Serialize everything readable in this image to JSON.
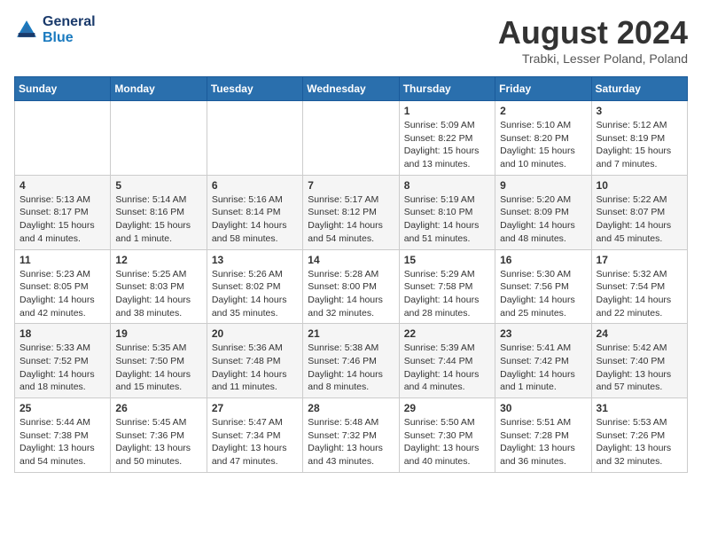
{
  "header": {
    "logo_line1": "General",
    "logo_line2": "Blue",
    "month": "August 2024",
    "location": "Trabki, Lesser Poland, Poland"
  },
  "days_of_week": [
    "Sunday",
    "Monday",
    "Tuesday",
    "Wednesday",
    "Thursday",
    "Friday",
    "Saturday"
  ],
  "weeks": [
    [
      {
        "day": "",
        "info": ""
      },
      {
        "day": "",
        "info": ""
      },
      {
        "day": "",
        "info": ""
      },
      {
        "day": "",
        "info": ""
      },
      {
        "day": "1",
        "info": "Sunrise: 5:09 AM\nSunset: 8:22 PM\nDaylight: 15 hours\nand 13 minutes."
      },
      {
        "day": "2",
        "info": "Sunrise: 5:10 AM\nSunset: 8:20 PM\nDaylight: 15 hours\nand 10 minutes."
      },
      {
        "day": "3",
        "info": "Sunrise: 5:12 AM\nSunset: 8:19 PM\nDaylight: 15 hours\nand 7 minutes."
      }
    ],
    [
      {
        "day": "4",
        "info": "Sunrise: 5:13 AM\nSunset: 8:17 PM\nDaylight: 15 hours\nand 4 minutes."
      },
      {
        "day": "5",
        "info": "Sunrise: 5:14 AM\nSunset: 8:16 PM\nDaylight: 15 hours\nand 1 minute."
      },
      {
        "day": "6",
        "info": "Sunrise: 5:16 AM\nSunset: 8:14 PM\nDaylight: 14 hours\nand 58 minutes."
      },
      {
        "day": "7",
        "info": "Sunrise: 5:17 AM\nSunset: 8:12 PM\nDaylight: 14 hours\nand 54 minutes."
      },
      {
        "day": "8",
        "info": "Sunrise: 5:19 AM\nSunset: 8:10 PM\nDaylight: 14 hours\nand 51 minutes."
      },
      {
        "day": "9",
        "info": "Sunrise: 5:20 AM\nSunset: 8:09 PM\nDaylight: 14 hours\nand 48 minutes."
      },
      {
        "day": "10",
        "info": "Sunrise: 5:22 AM\nSunset: 8:07 PM\nDaylight: 14 hours\nand 45 minutes."
      }
    ],
    [
      {
        "day": "11",
        "info": "Sunrise: 5:23 AM\nSunset: 8:05 PM\nDaylight: 14 hours\nand 42 minutes."
      },
      {
        "day": "12",
        "info": "Sunrise: 5:25 AM\nSunset: 8:03 PM\nDaylight: 14 hours\nand 38 minutes."
      },
      {
        "day": "13",
        "info": "Sunrise: 5:26 AM\nSunset: 8:02 PM\nDaylight: 14 hours\nand 35 minutes."
      },
      {
        "day": "14",
        "info": "Sunrise: 5:28 AM\nSunset: 8:00 PM\nDaylight: 14 hours\nand 32 minutes."
      },
      {
        "day": "15",
        "info": "Sunrise: 5:29 AM\nSunset: 7:58 PM\nDaylight: 14 hours\nand 28 minutes."
      },
      {
        "day": "16",
        "info": "Sunrise: 5:30 AM\nSunset: 7:56 PM\nDaylight: 14 hours\nand 25 minutes."
      },
      {
        "day": "17",
        "info": "Sunrise: 5:32 AM\nSunset: 7:54 PM\nDaylight: 14 hours\nand 22 minutes."
      }
    ],
    [
      {
        "day": "18",
        "info": "Sunrise: 5:33 AM\nSunset: 7:52 PM\nDaylight: 14 hours\nand 18 minutes."
      },
      {
        "day": "19",
        "info": "Sunrise: 5:35 AM\nSunset: 7:50 PM\nDaylight: 14 hours\nand 15 minutes."
      },
      {
        "day": "20",
        "info": "Sunrise: 5:36 AM\nSunset: 7:48 PM\nDaylight: 14 hours\nand 11 minutes."
      },
      {
        "day": "21",
        "info": "Sunrise: 5:38 AM\nSunset: 7:46 PM\nDaylight: 14 hours\nand 8 minutes."
      },
      {
        "day": "22",
        "info": "Sunrise: 5:39 AM\nSunset: 7:44 PM\nDaylight: 14 hours\nand 4 minutes."
      },
      {
        "day": "23",
        "info": "Sunrise: 5:41 AM\nSunset: 7:42 PM\nDaylight: 14 hours\nand 1 minute."
      },
      {
        "day": "24",
        "info": "Sunrise: 5:42 AM\nSunset: 7:40 PM\nDaylight: 13 hours\nand 57 minutes."
      }
    ],
    [
      {
        "day": "25",
        "info": "Sunrise: 5:44 AM\nSunset: 7:38 PM\nDaylight: 13 hours\nand 54 minutes."
      },
      {
        "day": "26",
        "info": "Sunrise: 5:45 AM\nSunset: 7:36 PM\nDaylight: 13 hours\nand 50 minutes."
      },
      {
        "day": "27",
        "info": "Sunrise: 5:47 AM\nSunset: 7:34 PM\nDaylight: 13 hours\nand 47 minutes."
      },
      {
        "day": "28",
        "info": "Sunrise: 5:48 AM\nSunset: 7:32 PM\nDaylight: 13 hours\nand 43 minutes."
      },
      {
        "day": "29",
        "info": "Sunrise: 5:50 AM\nSunset: 7:30 PM\nDaylight: 13 hours\nand 40 minutes."
      },
      {
        "day": "30",
        "info": "Sunrise: 5:51 AM\nSunset: 7:28 PM\nDaylight: 13 hours\nand 36 minutes."
      },
      {
        "day": "31",
        "info": "Sunrise: 5:53 AM\nSunset: 7:26 PM\nDaylight: 13 hours\nand 32 minutes."
      }
    ]
  ]
}
